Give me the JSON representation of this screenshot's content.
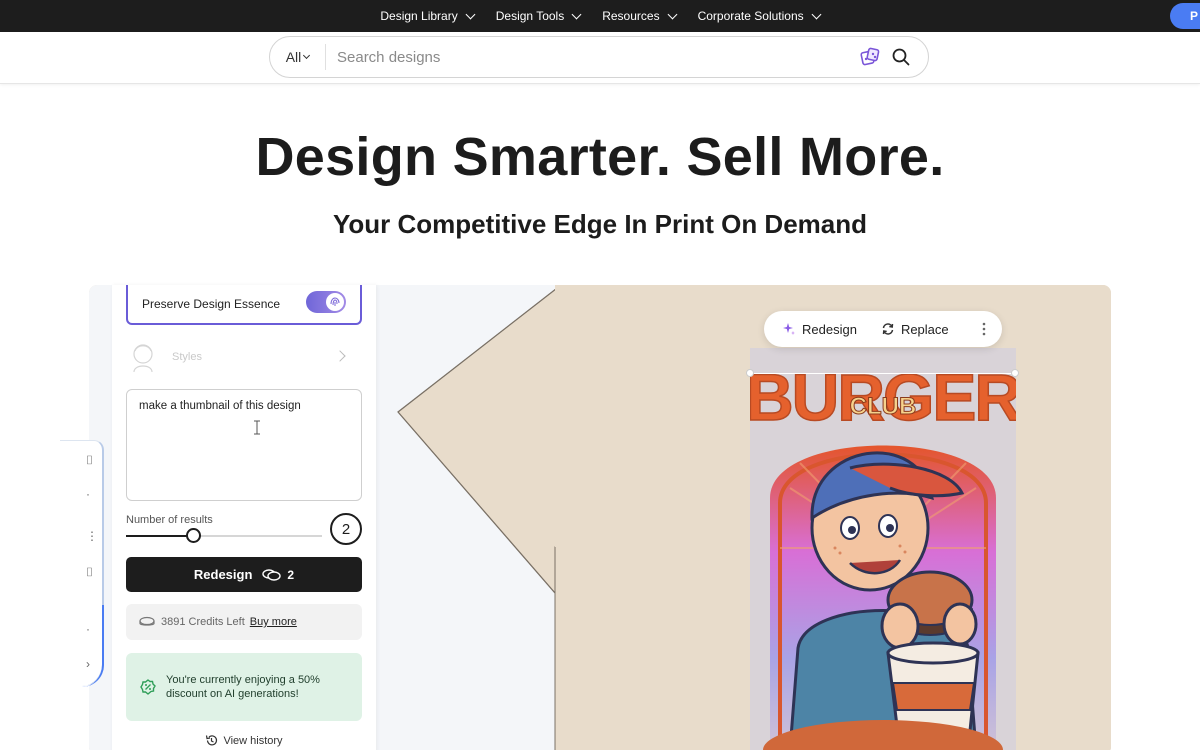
{
  "nav": {
    "items": [
      {
        "label": "Design Library"
      },
      {
        "label": "Design Tools"
      },
      {
        "label": "Resources"
      },
      {
        "label": "Corporate Solutions"
      }
    ],
    "cta_label": "P"
  },
  "search": {
    "category": "All",
    "placeholder": "Search designs"
  },
  "hero": {
    "title": "Design Smarter. Sell More.",
    "subtitle": "Your Competitive Edge In Print On Demand"
  },
  "panel": {
    "preserve_label": "Preserve Design Essence",
    "preserve_on": true,
    "styles_label": "Styles",
    "prompt_value": "make a thumbnail of this design",
    "results_label": "Number of results",
    "results_value": "2",
    "results_fraction": 0.34,
    "redesign_label": "Redesign",
    "redesign_cost": "2",
    "credits_text": "3891 Credits Left",
    "buy_more": "Buy more",
    "discount_text": "You're currently enjoying a 50% discount on AI generations!",
    "history_label": "View history"
  },
  "toolbar": {
    "redesign_label": "Redesign",
    "replace_label": "Replace"
  },
  "artwork": {
    "title": "BURGER",
    "subtitle": "CLUB"
  },
  "colors": {
    "accent": "#6a5cd8",
    "shirt": "#e8dccb",
    "discount_bg": "#dff2e6",
    "dark": "#1d1d1d"
  }
}
